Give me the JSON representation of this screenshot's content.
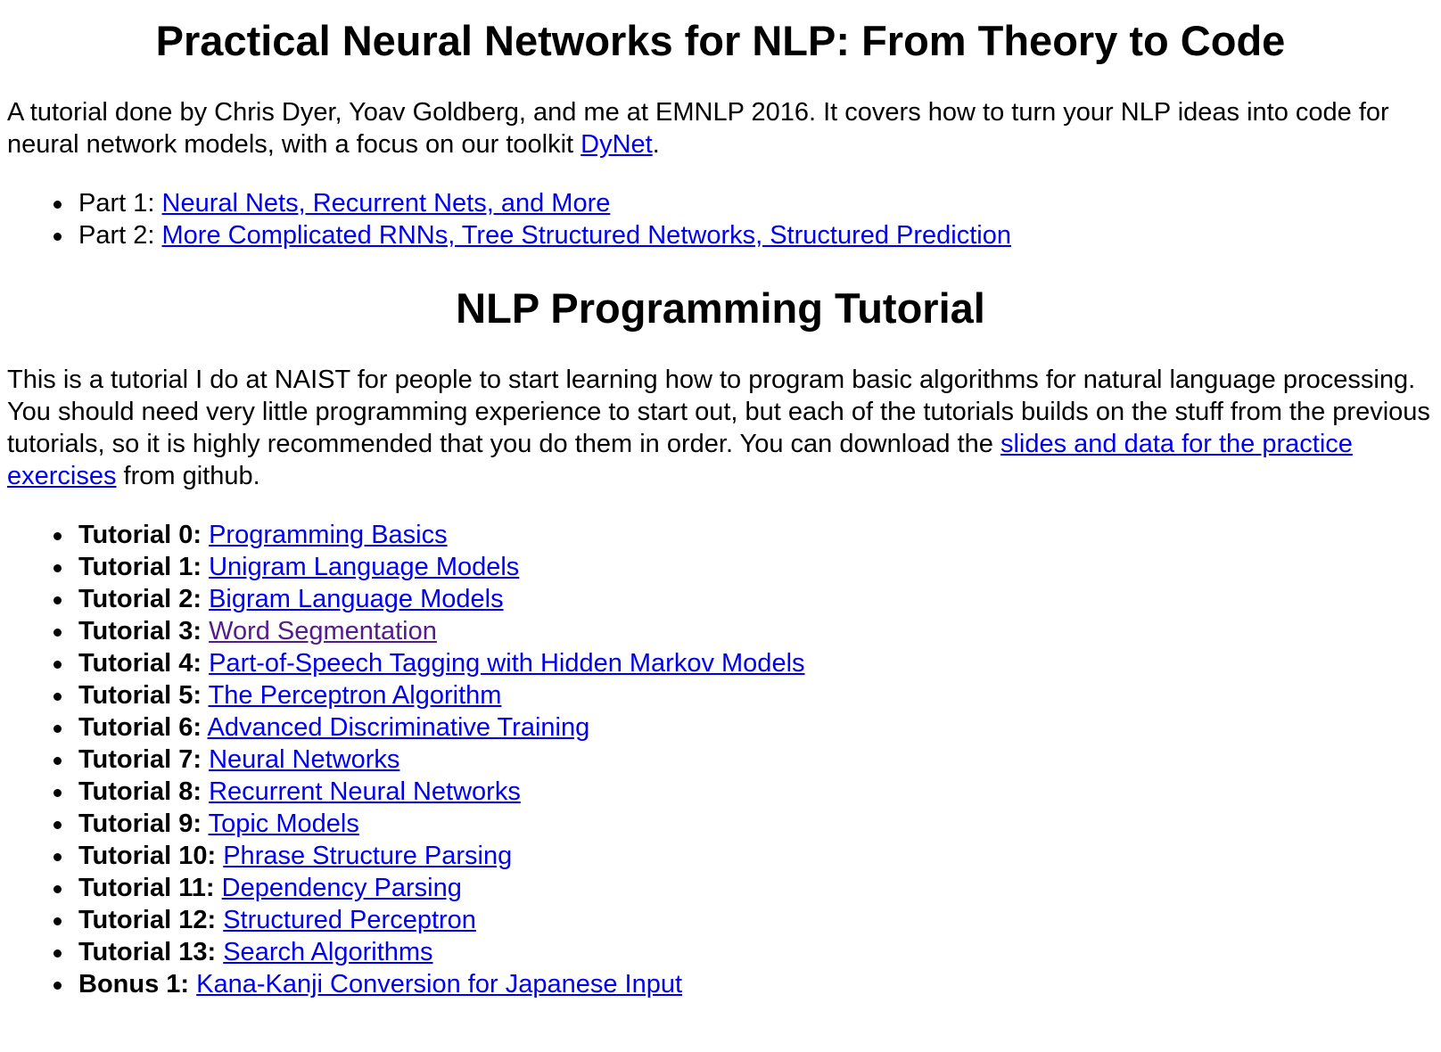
{
  "section1": {
    "title": "Practical Neural Networks for NLP: From Theory to Code",
    "intro_text": "A tutorial done by Chris Dyer, Yoav Goldberg, and me at EMNLP 2016. It covers how to turn your NLP ideas into code for neural network models, with a focus on our toolkit ",
    "intro_link": "DyNet",
    "intro_end": ".",
    "parts": [
      {
        "label": "Part 1: ",
        "link": "Neural Nets, Recurrent Nets, and More"
      },
      {
        "label": "Part 2: ",
        "link": "More Complicated RNNs, Tree Structured Networks, Structured Prediction"
      }
    ]
  },
  "section2": {
    "title": "NLP Programming Tutorial",
    "intro_text": "This is a tutorial I do at NAIST for people to start learning how to program basic algorithms for natural language processing. You should need very little programming experience to start out, but each of the tutorials builds on the stuff from the previous tutorials, so it is highly recommended that you do them in order. You can download the ",
    "intro_link": "slides and data for the practice exercises",
    "intro_end": " from github.",
    "tutorials": [
      {
        "label": "Tutorial 0:",
        "link": "Programming Basics"
      },
      {
        "label": "Tutorial 1:",
        "link": "Unigram Language Models"
      },
      {
        "label": "Tutorial 2:",
        "link": "Bigram Language Models"
      },
      {
        "label": "Tutorial 3:",
        "link": "Word Segmentation"
      },
      {
        "label": "Tutorial 4:",
        "link": "Part-of-Speech Tagging with Hidden Markov Models"
      },
      {
        "label": "Tutorial 5:",
        "link": "The Perceptron Algorithm"
      },
      {
        "label": "Tutorial 6:",
        "link": "Advanced Discriminative Training"
      },
      {
        "label": "Tutorial 7:",
        "link": "Neural Networks"
      },
      {
        "label": "Tutorial 8:",
        "link": "Recurrent Neural Networks"
      },
      {
        "label": "Tutorial 9:",
        "link": "Topic Models"
      },
      {
        "label": "Tutorial 10:",
        "link": "Phrase Structure Parsing"
      },
      {
        "label": "Tutorial 11:",
        "link": "Dependency Parsing"
      },
      {
        "label": "Tutorial 12:",
        "link": "Structured Perceptron"
      },
      {
        "label": "Tutorial 13:",
        "link": "Search Algorithms"
      },
      {
        "label": "Bonus 1:",
        "link": "Kana-Kanji Conversion for Japanese Input"
      }
    ]
  },
  "colors": {
    "link": "#0000ee",
    "visited_link": "#551a8b",
    "text": "#000000",
    "background": "#ffffff"
  }
}
